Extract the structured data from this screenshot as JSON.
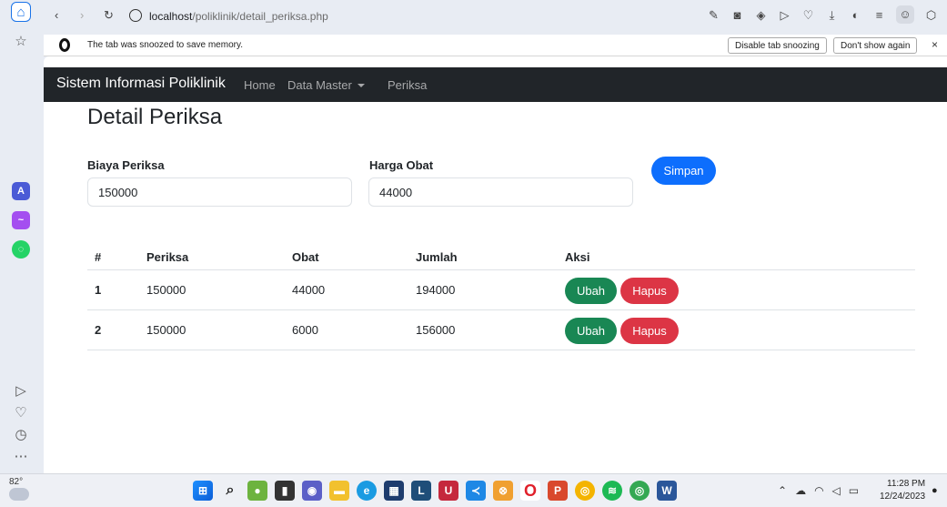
{
  "browser": {
    "url_host": "localhost",
    "url_path": "/poliklinik/detail_periksa.php"
  },
  "snooze_bar": {
    "message": "The tab was snoozed to save memory.",
    "disable_label": "Disable tab snoozing",
    "dont_show_label": "Don't show again",
    "close_glyph": "×"
  },
  "navbar": {
    "brand": "Sistem Informasi Poliklinik",
    "links": [
      "Home",
      "Data Master",
      "Periksa"
    ]
  },
  "page": {
    "title": "Detail Periksa",
    "biaya_label": "Biaya Periksa",
    "biaya_value": "150000",
    "harga_label": "Harga Obat",
    "harga_value": "44000",
    "save_label": "Simpan"
  },
  "table": {
    "headers": [
      "#",
      "Periksa",
      "Obat",
      "Jumlah",
      "Aksi"
    ],
    "rows": [
      {
        "no": "1",
        "periksa": "150000",
        "obat": "44000",
        "jumlah": "194000",
        "edit": "Ubah",
        "delete": "Hapus"
      },
      {
        "no": "2",
        "periksa": "150000",
        "obat": "6000",
        "jumlah": "156000",
        "edit": "Ubah",
        "delete": "Hapus"
      }
    ]
  },
  "taskbar": {
    "weather": "82°",
    "time": "11:28 PM",
    "date": "12/24/2023"
  },
  "colors": {
    "primary": "#0d6efd",
    "success": "#198754",
    "danger": "#dc3545",
    "navbar": "#212529"
  }
}
